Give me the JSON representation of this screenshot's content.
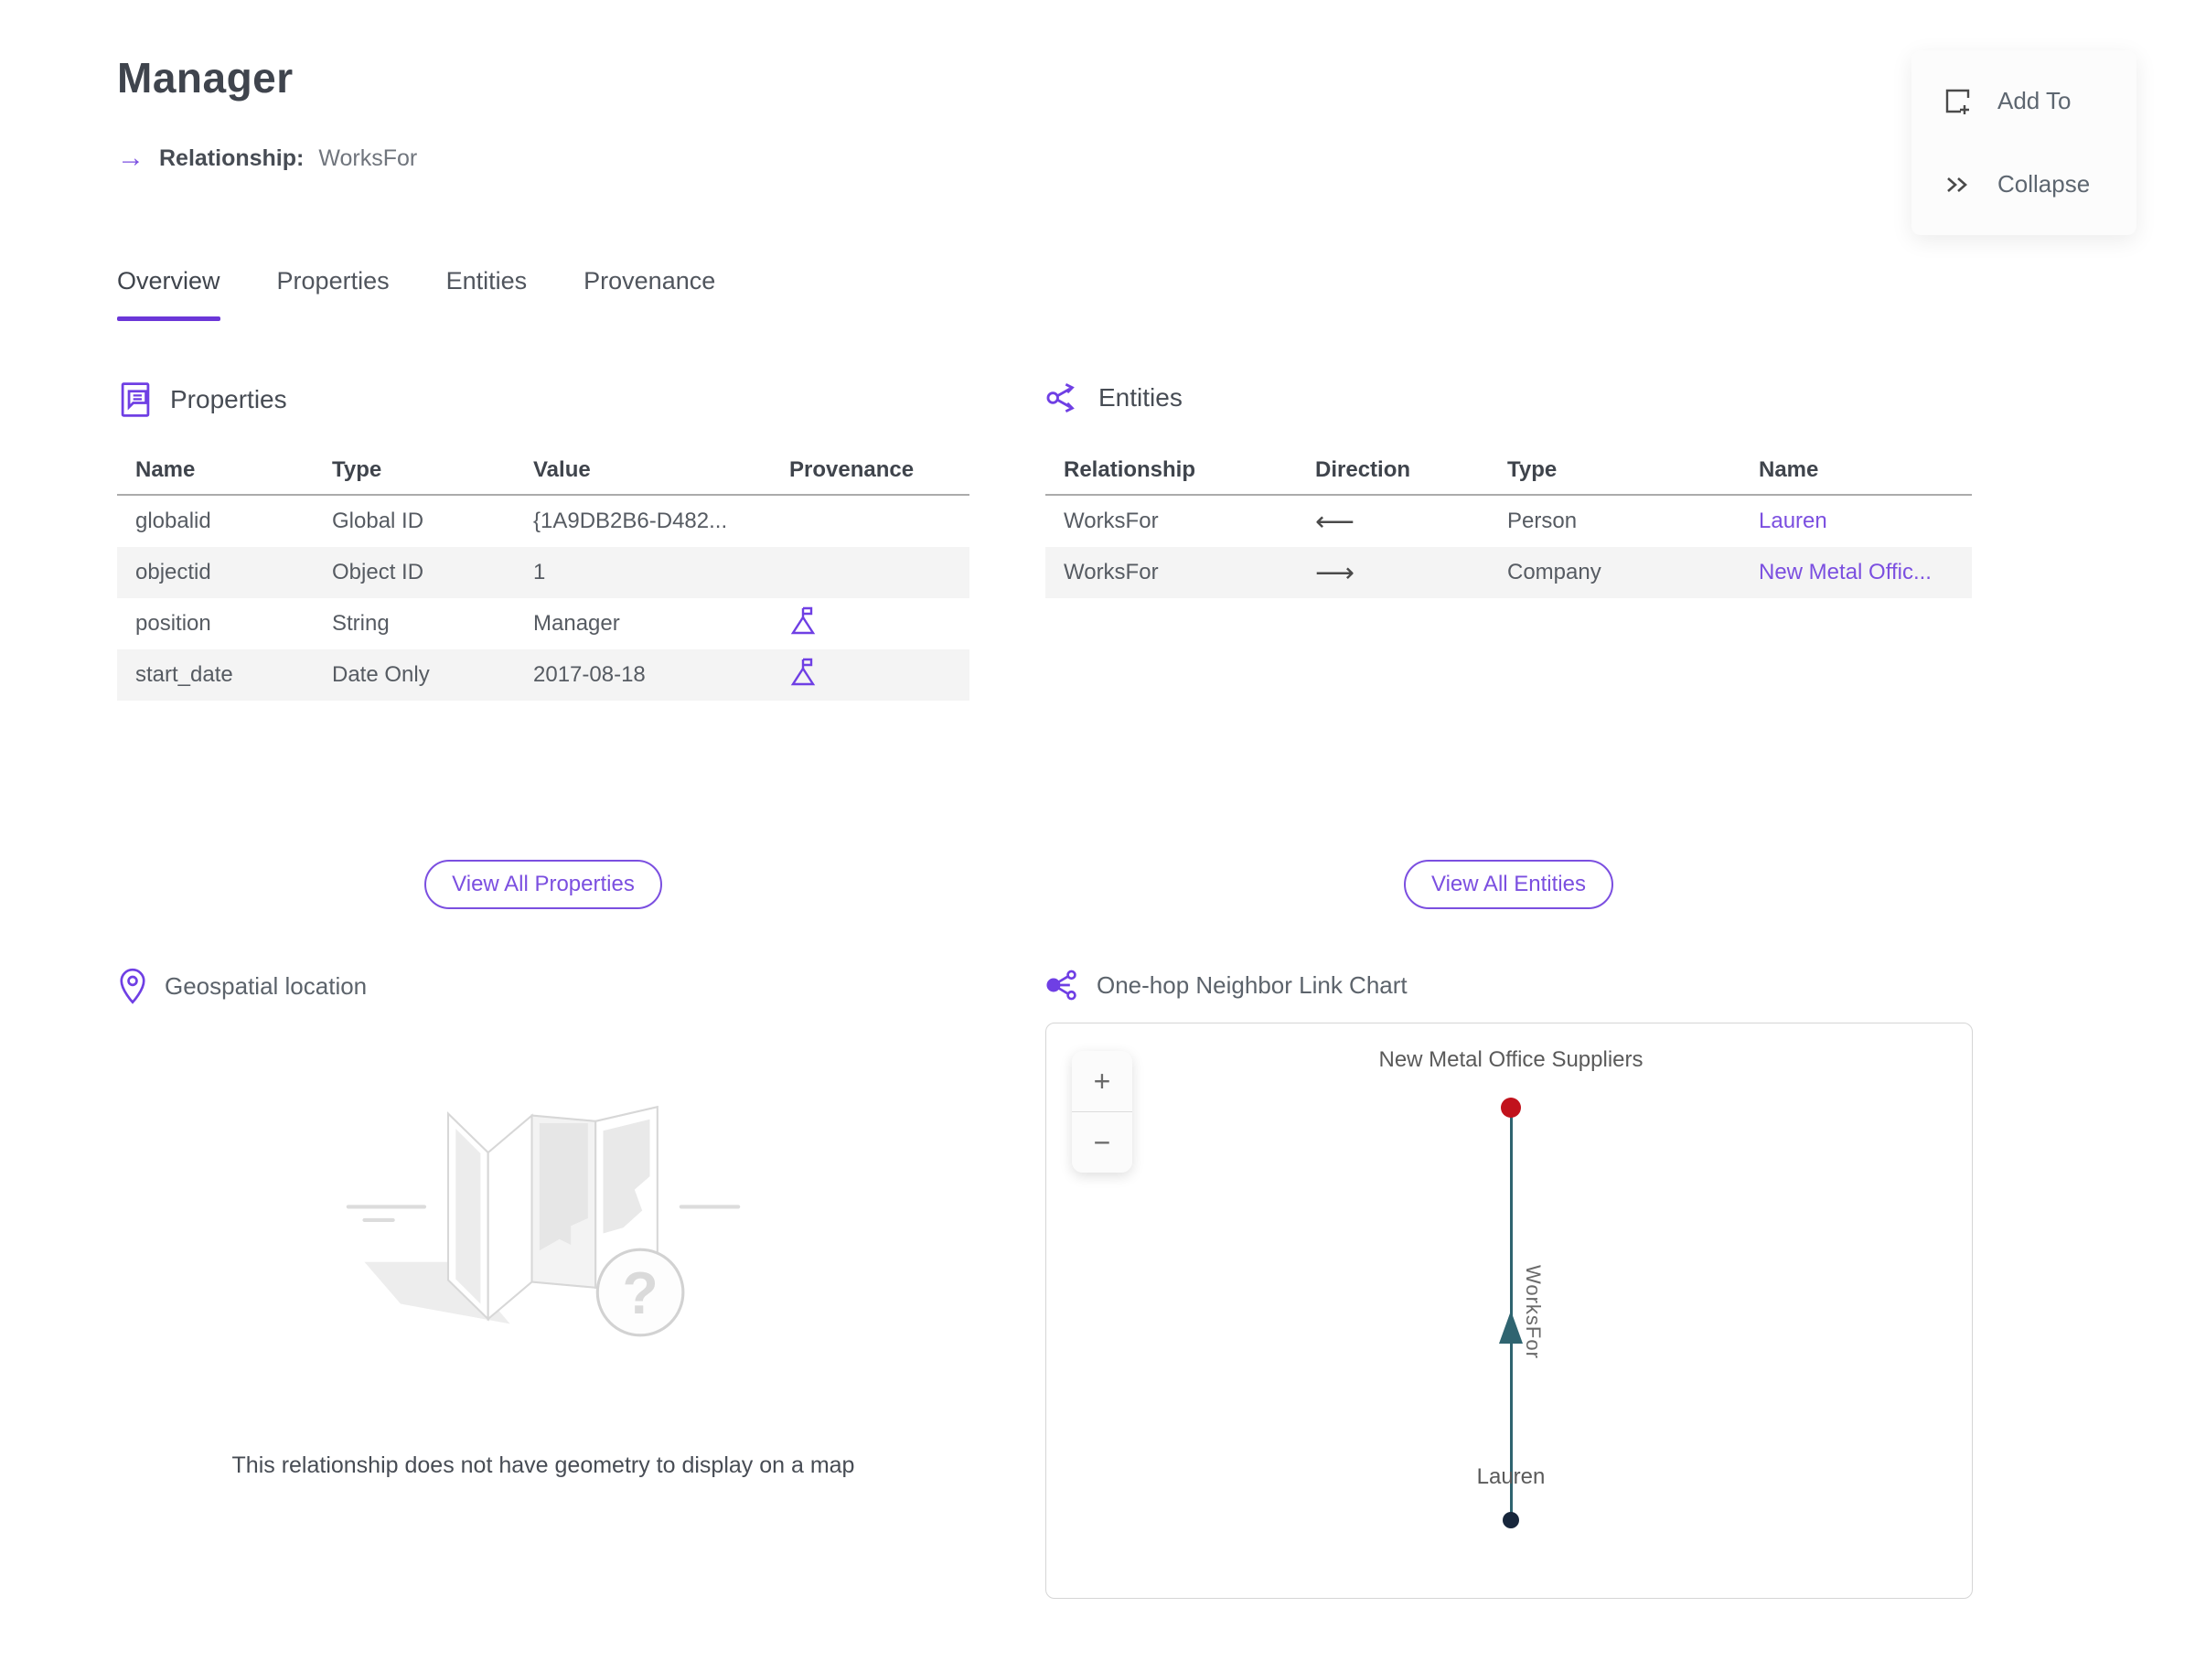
{
  "page": {
    "title": "Manager",
    "subtitle_label": "Relationship:",
    "subtitle_value": "WorksFor",
    "subtitle_arrow": "→"
  },
  "actions": {
    "add_to": "Add To",
    "collapse": "Collapse"
  },
  "tabs": [
    {
      "label": "Overview",
      "active": true
    },
    {
      "label": "Properties",
      "active": false
    },
    {
      "label": "Entities",
      "active": false
    },
    {
      "label": "Provenance",
      "active": false
    }
  ],
  "properties_section": {
    "title": "Properties",
    "columns": {
      "c1": "Name",
      "c2": "Type",
      "c3": "Value",
      "c4": "Provenance"
    },
    "rows": [
      {
        "name": "globalid",
        "type": "Global ID",
        "value": "{1A9DB2B6-D482...",
        "has_provenance": false
      },
      {
        "name": "objectid",
        "type": "Object ID",
        "value": "1",
        "has_provenance": false
      },
      {
        "name": "position",
        "type": "String",
        "value": "Manager",
        "has_provenance": true
      },
      {
        "name": "start_date",
        "type": "Date Only",
        "value": "2017-08-18",
        "has_provenance": true
      }
    ],
    "view_all_label": "View All Properties"
  },
  "entities_section": {
    "title": "Entities",
    "columns": {
      "c1": "Relationship",
      "c2": "Direction",
      "c3": "Type",
      "c4": "Name"
    },
    "rows": [
      {
        "relationship": "WorksFor",
        "direction": "⟵",
        "type": "Person",
        "name": "Lauren"
      },
      {
        "relationship": "WorksFor",
        "direction": "⟶",
        "type": "Company",
        "name": "New Metal Offic..."
      }
    ],
    "view_all_label": "View All Entities"
  },
  "geospatial_section": {
    "title": "Geospatial location",
    "empty_message": "This relationship does not have geometry to display on a map"
  },
  "link_chart_section": {
    "title": "One-hop Neighbor Link Chart",
    "zoom_in": "+",
    "zoom_out": "−",
    "top_node": {
      "label": "New Metal Office Suppliers",
      "color": "#c1121c"
    },
    "bottom_node": {
      "label": "Lauren",
      "color": "#17263b"
    },
    "edge": {
      "label": "WorksFor",
      "color": "#2f6470"
    }
  },
  "colors": {
    "accent_purple": "#7b4fe0",
    "tab_underline": "#6b37d8",
    "row_stripe": "#f4f4f4",
    "edge_teal": "#2f6470",
    "node_red": "#c1121c",
    "node_navy": "#17263b"
  }
}
